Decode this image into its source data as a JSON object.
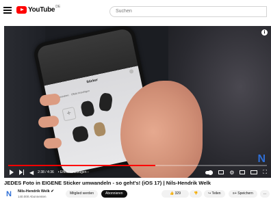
{
  "header": {
    "logo_text": "YouTube",
    "logo_country": "DE",
    "search_placeholder": "Suchen"
  },
  "player": {
    "time": "2:38 / 4:36",
    "chapter": "• Effekt hinzufügen ›",
    "progress_fraction": 0.57,
    "watermark": "N",
    "sticker_sheet": {
      "title": "Sticker",
      "tabs": [
        "Neu anordnen",
        "Effekt hinzufügen"
      ]
    }
  },
  "video": {
    "title": "JEDES Foto in EIGENE Sticker umwandeln - so geht's! (iOS 17) | Nils-Hendrik Welk"
  },
  "channel": {
    "name": "Nils-Hendrik Welk",
    "verified": "✔",
    "subscribers": "140.000 Abonnenten",
    "avatar_letter": "N",
    "member_label": "Mitglied werden",
    "subscribe_label": "Abonnieren"
  },
  "actions": {
    "likes": "329",
    "share_label": "Teilen",
    "save_label": "Speichern",
    "more_label": "..."
  },
  "colors": {
    "brand_red": "#ff0000",
    "watermark_blue": "#2f6fd6"
  }
}
